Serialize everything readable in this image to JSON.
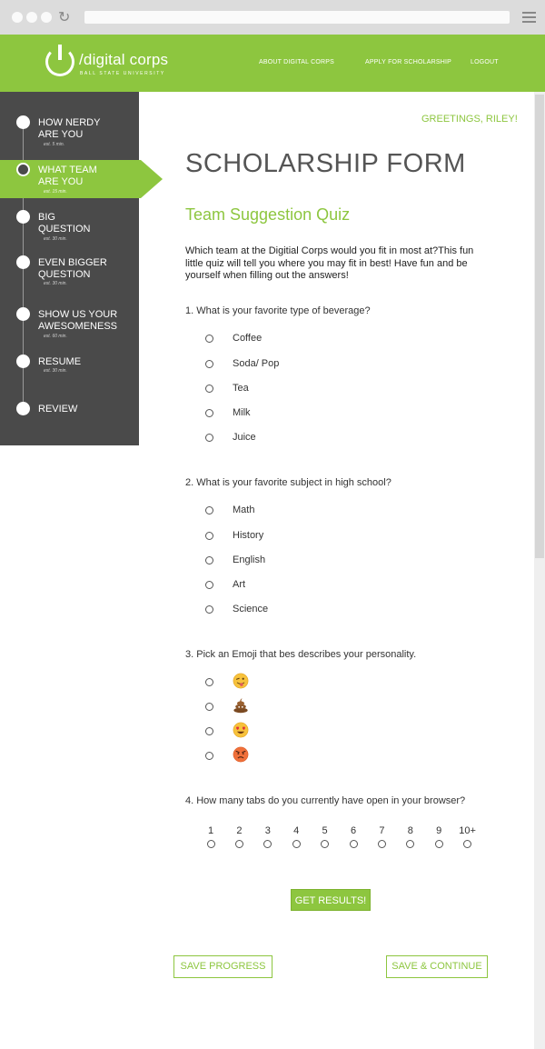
{
  "browser": {
    "reload_icon": "reload-icon",
    "menu_icon": "hamburger-menu-icon"
  },
  "header": {
    "logo_text": "/digital corps",
    "logo_subtext": "BALL STATE UNIVERSITY",
    "nav": [
      "ABOUT DIGITAL CORPS",
      "APPLY FOR SCHOLARSHIP",
      "LOGOUT"
    ],
    "brand_color": "#8dc63f"
  },
  "sidebar": {
    "steps": [
      {
        "title": "HOW NERDY\nARE YOU",
        "est": "est. 5 min."
      },
      {
        "title": "WHAT TEAM\nARE YOU",
        "est": "est. 15 min."
      },
      {
        "title": "BIG\nQUESTION",
        "est": "est. 30 min."
      },
      {
        "title": "EVEN BIGGER\nQUESTION",
        "est": "est. 30 min."
      },
      {
        "title": "SHOW US YOUR\nAWESOMENESS",
        "est": "est. 60 min."
      },
      {
        "title": "RESUME",
        "est": "est. 30 min."
      },
      {
        "title": "REVIEW",
        "est": ""
      }
    ],
    "active_index": 1
  },
  "main": {
    "greeting": "GREETINGS, RILEY!",
    "form_title": "SCHOLARSHIP FORM",
    "quiz_title": "Team Suggestion Quiz",
    "intro": "Which team at the Digitial Corps would you fit in most at?This fun little quiz will tell you where you may fit in best! Have fun and be yourself when filling out the answers!",
    "questions": [
      {
        "text": "1. What is your favorite type of beverage?",
        "options": [
          "Coffee",
          "Soda/ Pop",
          "Tea",
          "Milk",
          "Juice"
        ]
      },
      {
        "text": "2. What is your favorite subject in high school?",
        "options": [
          "Math",
          "History",
          "English",
          "Art",
          "Science"
        ]
      },
      {
        "text": "3. Pick an Emoji that bes describes your personality.",
        "options": [
          "winking-tongue-emoji",
          "poop-emoji",
          "heart-eyes-emoji",
          "angry-face-emoji"
        ]
      },
      {
        "text": "4. How many tabs do you currently have open in your browser?",
        "scale": [
          "1",
          "2",
          "3",
          "4",
          "5",
          "6",
          "7",
          "8",
          "9",
          "10+"
        ]
      }
    ],
    "get_results_label": "GET RESULTS!",
    "save_progress_label": "SAVE PROGRESS",
    "save_continue_label": "SAVE & CONTINUE"
  }
}
